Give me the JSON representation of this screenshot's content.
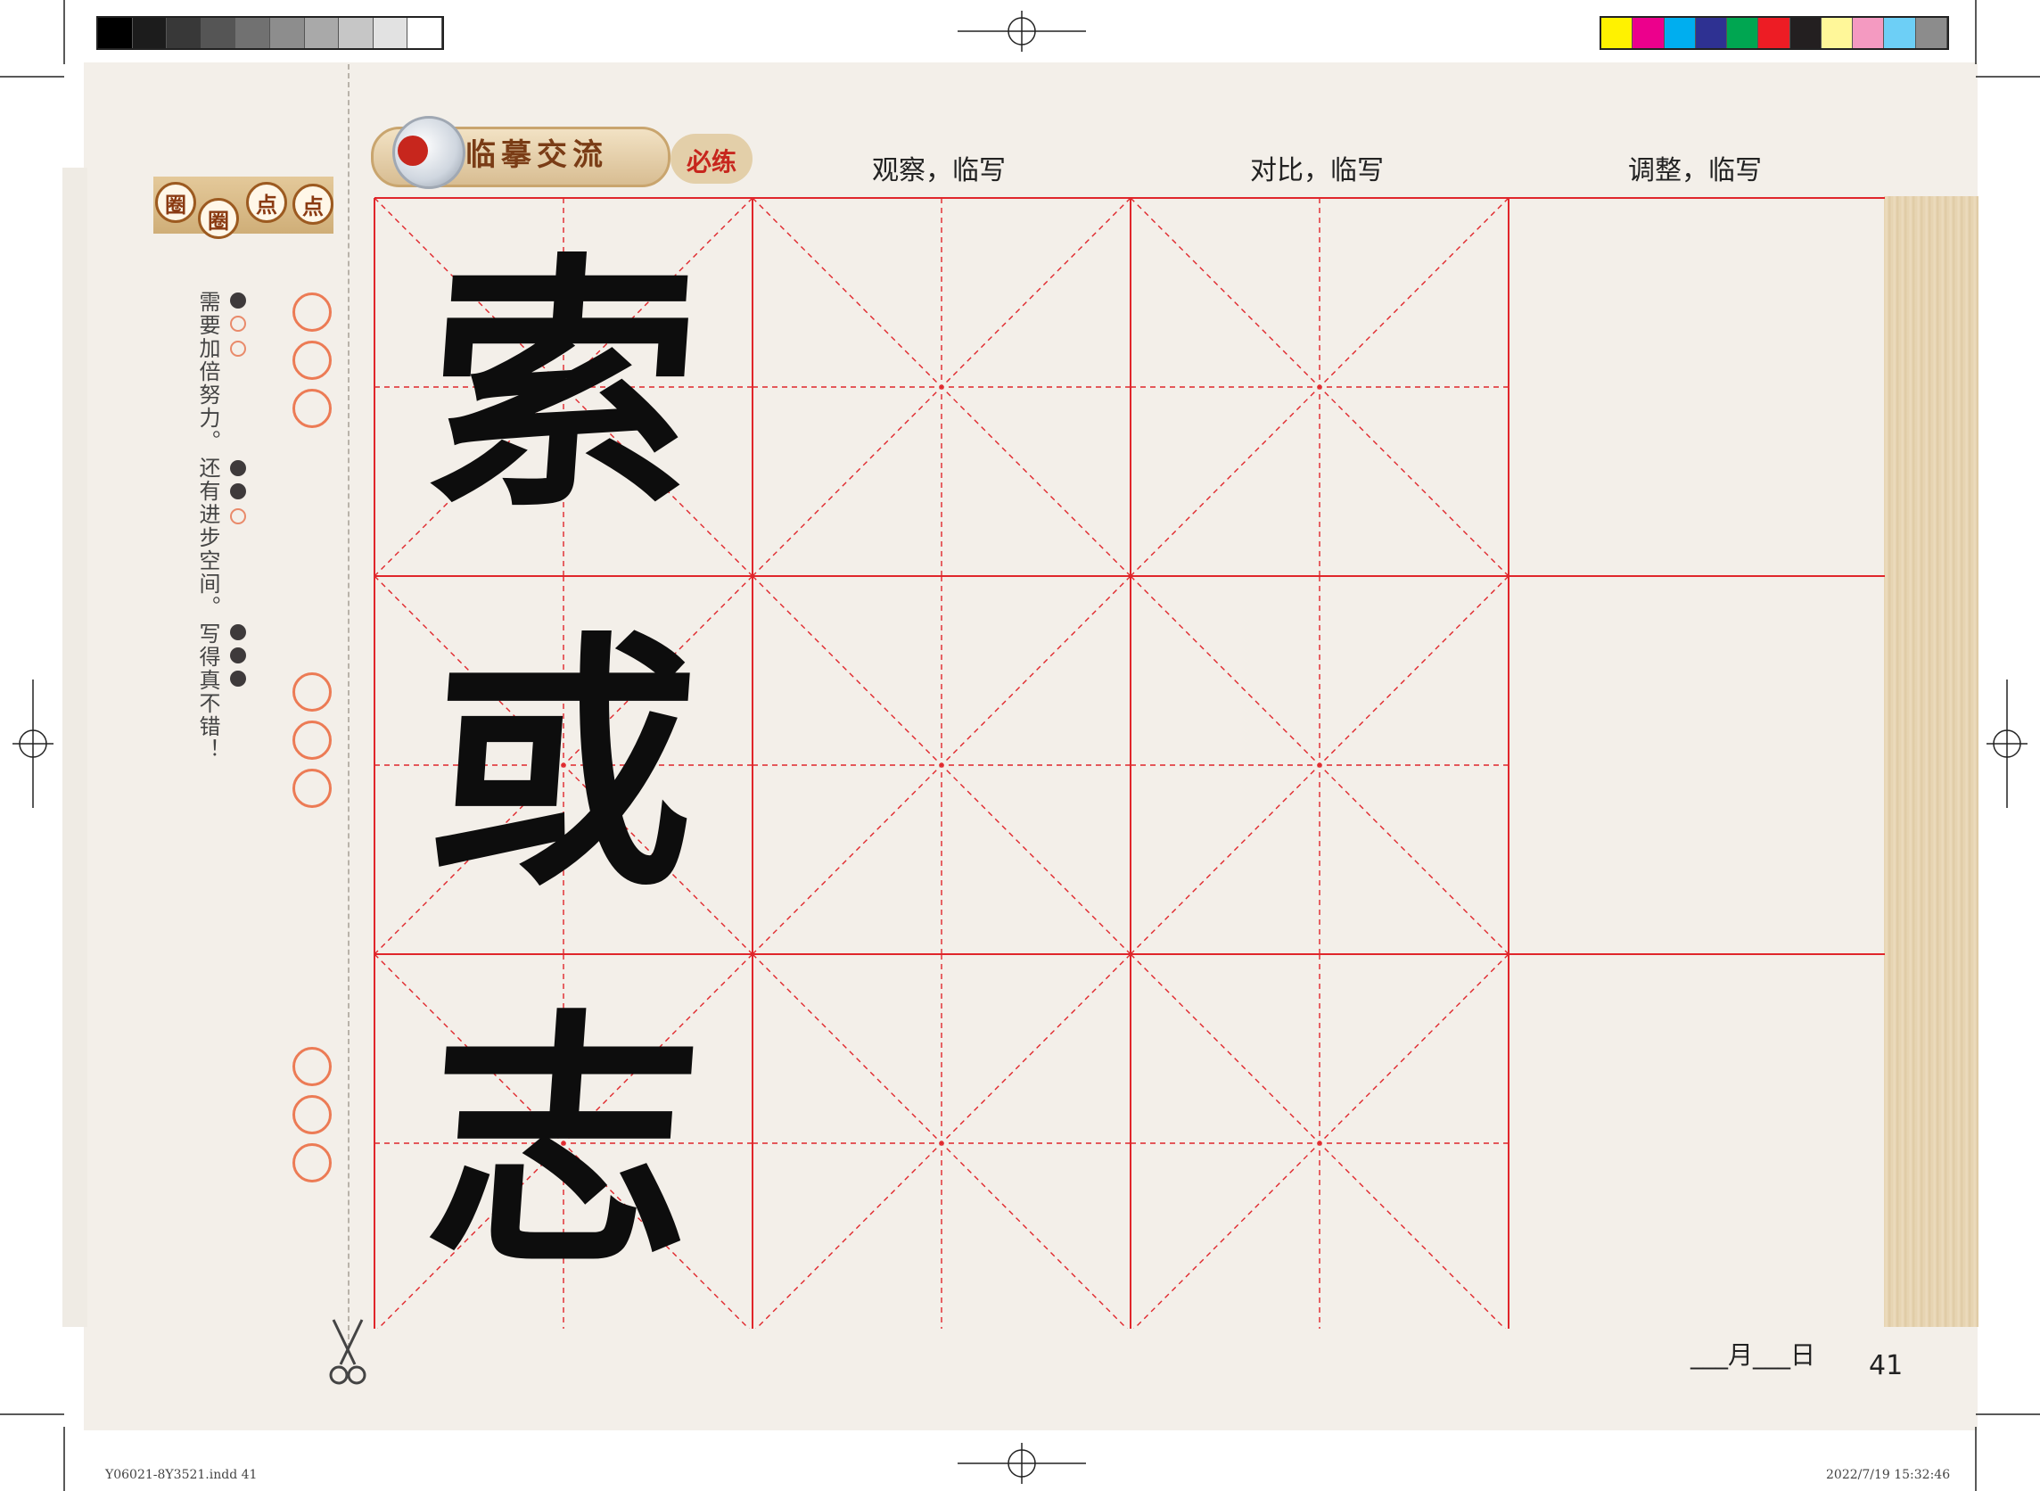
{
  "header": {
    "title": "临摹交流",
    "tag": "必练",
    "columns": [
      "观察，临写",
      "对比，临写",
      "调整，临写"
    ]
  },
  "sidebar": {
    "badge": [
      "圈",
      "圈",
      "点",
      "点"
    ],
    "ratings": [
      {
        "text": "需要加倍努力。",
        "filled": 1
      },
      {
        "text": "还有进步空间。",
        "filled": 2
      },
      {
        "text": "写得真不错！",
        "filled": 3
      }
    ]
  },
  "characters": [
    "索",
    "或",
    "志"
  ],
  "footer": {
    "date_label": "___月___日",
    "page_number": "41",
    "file_name": "Y06021-8Y3521.indd   41",
    "timestamp": "2022/7/19   15:32:46"
  },
  "colors": {
    "grid_red": "#e0262b",
    "ring_orange": "#ec7b55",
    "paper": "#f3efe9"
  },
  "color_bars": {
    "gray": [
      "#000000",
      "#1c1c1c",
      "#383838",
      "#555555",
      "#717171",
      "#8d8d8d",
      "#a9a9a9",
      "#c6c6c6",
      "#e2e2e2",
      "#ffffff"
    ],
    "process": [
      "#fff200",
      "#ec008c",
      "#00aeef",
      "#2e3192",
      "#00a651",
      "#ed1c24",
      "#231f20",
      "#fff799",
      "#f49ac1",
      "#6dcff6",
      "#8c8c8c"
    ]
  }
}
